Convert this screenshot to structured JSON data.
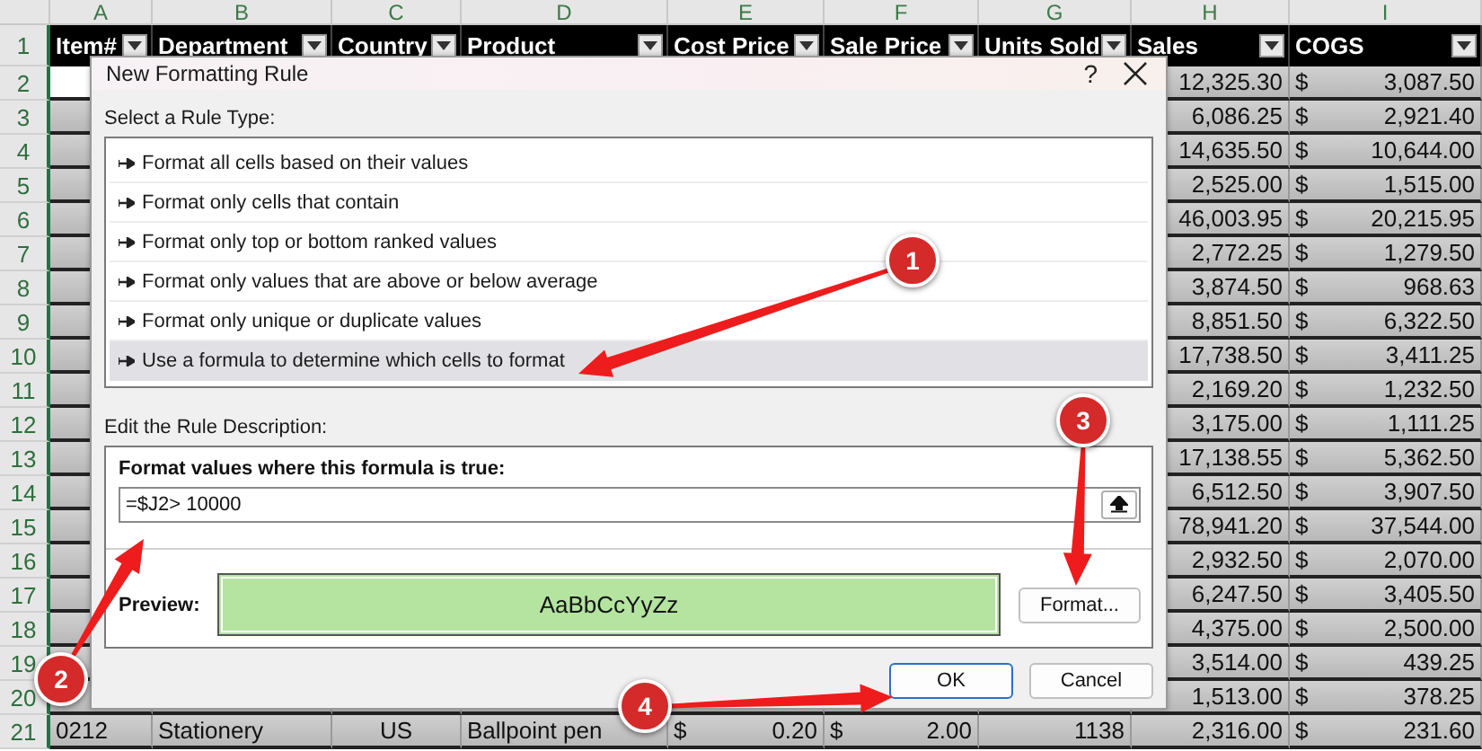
{
  "sheet": {
    "column_letters": [
      "A",
      "B",
      "C",
      "D",
      "E",
      "F",
      "G",
      "H",
      "I"
    ],
    "header": [
      "Item#",
      "Department",
      "Country",
      "Product",
      "Cost Price",
      "Sale Price",
      "Units Sold",
      "Sales",
      "COGS"
    ],
    "header_row_number": "1",
    "rows": [
      {
        "number": "2",
        "selected": true,
        "sales": "12,325.30",
        "cogs_currency": "$",
        "cogs": "3,087.50"
      },
      {
        "number": "3",
        "selected": false,
        "sales": "6,086.25",
        "cogs_currency": "$",
        "cogs": "2,921.40"
      },
      {
        "number": "4",
        "selected": false,
        "sales": "14,635.50",
        "cogs_currency": "$",
        "cogs": "10,644.00"
      },
      {
        "number": "5",
        "selected": false,
        "sales": "2,525.00",
        "cogs_currency": "$",
        "cogs": "1,515.00"
      },
      {
        "number": "6",
        "selected": false,
        "sales": "46,003.95",
        "cogs_currency": "$",
        "cogs": "20,215.95"
      },
      {
        "number": "7",
        "selected": false,
        "sales": "2,772.25",
        "cogs_currency": "$",
        "cogs": "1,279.50"
      },
      {
        "number": "8",
        "selected": false,
        "sales": "3,874.50",
        "cogs_currency": "$",
        "cogs": "968.63"
      },
      {
        "number": "9",
        "selected": false,
        "sales": "8,851.50",
        "cogs_currency": "$",
        "cogs": "6,322.50"
      },
      {
        "number": "10",
        "selected": false,
        "sales": "17,738.50",
        "cogs_currency": "$",
        "cogs": "3,411.25"
      },
      {
        "number": "11",
        "selected": false,
        "sales": "2,169.20",
        "cogs_currency": "$",
        "cogs": "1,232.50"
      },
      {
        "number": "12",
        "selected": false,
        "sales": "3,175.00",
        "cogs_currency": "$",
        "cogs": "1,111.25"
      },
      {
        "number": "13",
        "selected": false,
        "sales": "17,138.55",
        "cogs_currency": "$",
        "cogs": "5,362.50"
      },
      {
        "number": "14",
        "selected": false,
        "sales": "6,512.50",
        "cogs_currency": "$",
        "cogs": "3,907.50"
      },
      {
        "number": "15",
        "selected": false,
        "sales": "78,941.20",
        "cogs_currency": "$",
        "cogs": "37,544.00"
      },
      {
        "number": "16",
        "selected": false,
        "sales": "2,932.50",
        "cogs_currency": "$",
        "cogs": "2,070.00"
      },
      {
        "number": "17",
        "selected": false,
        "sales": "6,247.50",
        "cogs_currency": "$",
        "cogs": "3,405.50"
      },
      {
        "number": "18",
        "selected": false,
        "sales": "4,375.00",
        "cogs_currency": "$",
        "cogs": "2,500.00"
      },
      {
        "number": "19",
        "selected": false,
        "sales": "3,514.00",
        "cogs_currency": "$",
        "cogs": "439.25"
      },
      {
        "number": "20",
        "selected": false,
        "sales": "1,513.00",
        "cogs_currency": "$",
        "cogs": "378.25"
      },
      {
        "number": "21",
        "selected": false,
        "item": "0212",
        "department": "Stationery",
        "country": "US",
        "product": "Ballpoint pen",
        "cost_currency": "$",
        "cost": "0.20",
        "sale_currency": "$",
        "sale": "2.00",
        "units": "1138",
        "sales": "2,316.00",
        "cogs_currency": "$",
        "cogs": "231.60"
      }
    ]
  },
  "dialog": {
    "title": "New Formatting Rule",
    "help": "?",
    "rule_type_label": "Select a Rule Type:",
    "rule_types": [
      {
        "label": "Format all cells based on their values",
        "selected": false
      },
      {
        "label": "Format only cells that contain",
        "selected": false
      },
      {
        "label": "Format only top or bottom ranked values",
        "selected": false
      },
      {
        "label": "Format only values that are above or below average",
        "selected": false
      },
      {
        "label": "Format only unique or duplicate values",
        "selected": false
      },
      {
        "label": "Use a formula to determine which cells to format",
        "selected": true
      }
    ],
    "description_label": "Edit the Rule Description:",
    "formula_label": "Format values where this formula is true:",
    "formula": "=$J2> 10000",
    "preview_label": "Preview:",
    "preview_text": "AaBbCcYyZz",
    "format_button": "Format...",
    "ok_button": "OK",
    "cancel_button": "Cancel"
  },
  "annotations": [
    {
      "number": "1"
    },
    {
      "number": "2"
    },
    {
      "number": "3"
    },
    {
      "number": "4"
    }
  ]
}
